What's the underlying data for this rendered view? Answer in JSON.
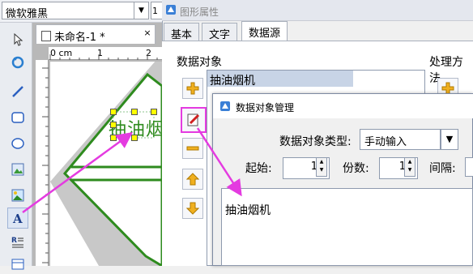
{
  "font_bar": {
    "font_name": "微软雅黑",
    "size_partial": "1"
  },
  "document": {
    "tab_title": "未命名-1 *",
    "ruler_unit": "0 cm",
    "ruler_ticks": [
      "1",
      "2"
    ],
    "canvas_text": "抽油烟"
  },
  "dialog": {
    "title": "图形属性",
    "tabs": [
      {
        "label": "基本"
      },
      {
        "label": "文字"
      },
      {
        "label": "数据源"
      }
    ],
    "data_objects_label": "数据对象",
    "processing_label": "处理方法",
    "data_object_items": [
      "抽油烟机"
    ]
  },
  "subdialog": {
    "title": "数据对象管理",
    "type_label": "数据对象类型:",
    "type_value": "手动输入",
    "start_label": "起始:",
    "start_value": "1",
    "copies_label": "份数:",
    "copies_value": "1",
    "interval_label": "间隔:",
    "content": "抽油烟机"
  },
  "colors": {
    "accent_magenta": "#e43be0",
    "shape_green": "#2e8b1e",
    "handle_yellow": "#ffff00"
  }
}
